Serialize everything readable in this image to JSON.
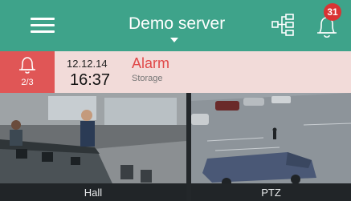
{
  "header": {
    "menu_icon": "hamburger-menu-icon",
    "server_name": "Demo server",
    "layout_icon": "layout-tree-icon",
    "notifications_icon": "bell-icon",
    "notification_count": "31",
    "accent_color": "#3ea38a"
  },
  "alarm": {
    "icon": "bell-icon",
    "counter": "2/3",
    "date": "12.12.14",
    "time": "16:37",
    "type": "Alarm",
    "source": "Storage",
    "alarm_color": "#e05656",
    "background_color": "#f2dbd9"
  },
  "cameras": [
    {
      "label": "Hall"
    },
    {
      "label": "PTZ"
    }
  ]
}
